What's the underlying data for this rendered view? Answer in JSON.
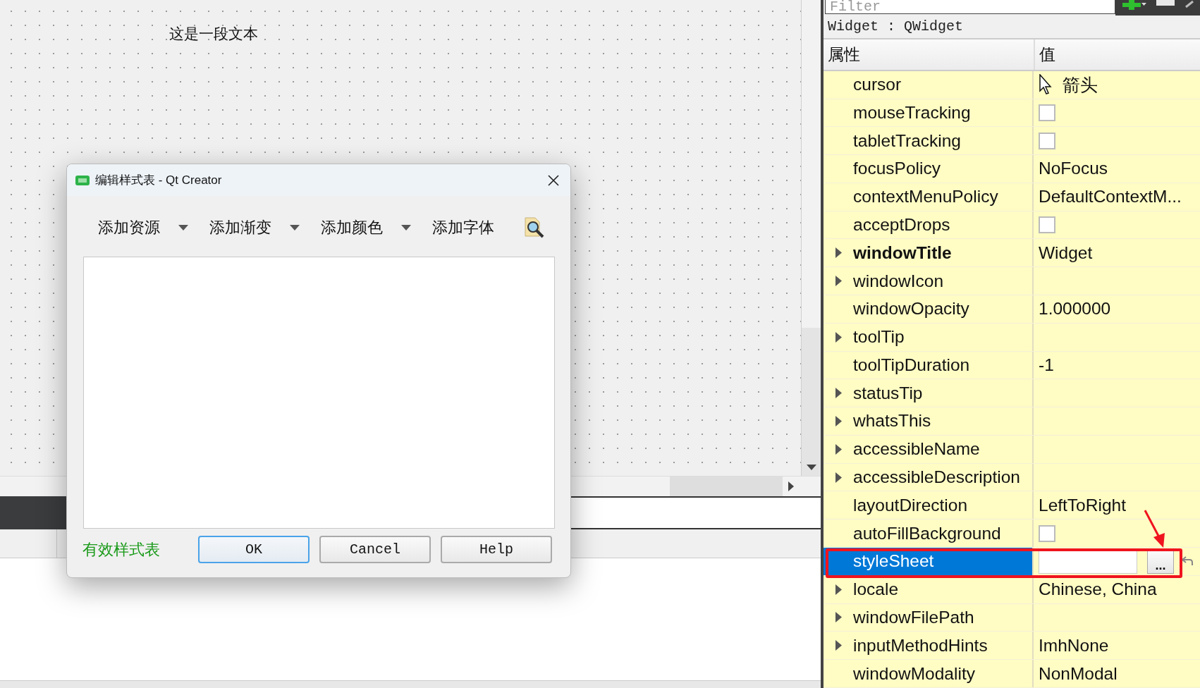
{
  "canvas": {
    "label": "这是一段文本"
  },
  "dialog": {
    "title": "编辑样式表 - Qt Creator",
    "toolbar": [
      {
        "label": "添加资源",
        "kind": "menu"
      },
      {
        "label": "添加渐变",
        "kind": "menu"
      },
      {
        "label": "添加颜色",
        "kind": "menu"
      },
      {
        "label": "添加字体",
        "kind": "plain"
      }
    ],
    "status": "有效样式表",
    "buttons": [
      {
        "label": "OK",
        "default": true
      },
      {
        "label": "Cancel",
        "default": false
      },
      {
        "label": "Help",
        "default": false
      }
    ]
  },
  "property_editor": {
    "filter": {
      "placeholder": "Filter"
    },
    "object": "Widget : QWidget",
    "columns": [
      "属性",
      "值"
    ],
    "rows": [
      {
        "name": "cursor",
        "kind": "cursor",
        "value": "箭头",
        "expandable": false,
        "bold": false,
        "selected": false
      },
      {
        "name": "mouseTracking",
        "kind": "checkbox",
        "checked": false,
        "expandable": false,
        "bold": false,
        "selected": false
      },
      {
        "name": "tabletTracking",
        "kind": "checkbox",
        "checked": false,
        "expandable": false,
        "bold": false,
        "selected": false
      },
      {
        "name": "focusPolicy",
        "kind": "text",
        "value": "NoFocus",
        "expandable": false,
        "bold": false,
        "selected": false
      },
      {
        "name": "contextMenuPolicy",
        "kind": "text",
        "value": "DefaultContextM...",
        "expandable": false,
        "bold": false,
        "selected": false
      },
      {
        "name": "acceptDrops",
        "kind": "checkbox",
        "checked": false,
        "expandable": false,
        "bold": false,
        "selected": false
      },
      {
        "name": "windowTitle",
        "kind": "text",
        "value": "Widget",
        "expandable": true,
        "bold": true,
        "selected": false
      },
      {
        "name": "windowIcon",
        "kind": "empty",
        "expandable": true,
        "bold": false,
        "selected": false
      },
      {
        "name": "windowOpacity",
        "kind": "text",
        "value": "1.000000",
        "expandable": false,
        "bold": false,
        "selected": false
      },
      {
        "name": "toolTip",
        "kind": "empty",
        "expandable": true,
        "bold": false,
        "selected": false
      },
      {
        "name": "toolTipDuration",
        "kind": "text",
        "value": "-1",
        "expandable": false,
        "bold": false,
        "selected": false
      },
      {
        "name": "statusTip",
        "kind": "empty",
        "expandable": true,
        "bold": false,
        "selected": false
      },
      {
        "name": "whatsThis",
        "kind": "empty",
        "expandable": true,
        "bold": false,
        "selected": false
      },
      {
        "name": "accessibleName",
        "kind": "empty",
        "expandable": true,
        "bold": false,
        "selected": false
      },
      {
        "name": "accessibleDescription",
        "kind": "empty",
        "expandable": true,
        "bold": false,
        "selected": false
      },
      {
        "name": "layoutDirection",
        "kind": "text",
        "value": "LeftToRight",
        "expandable": false,
        "bold": false,
        "selected": false
      },
      {
        "name": "autoFillBackground",
        "kind": "checkbox",
        "checked": false,
        "expandable": false,
        "bold": false,
        "selected": false
      },
      {
        "name": "styleSheet",
        "kind": "editor",
        "button": "...",
        "expandable": false,
        "bold": false,
        "selected": true
      },
      {
        "name": "locale",
        "kind": "text",
        "value": "Chinese, China",
        "expandable": true,
        "bold": false,
        "selected": false
      },
      {
        "name": "windowFilePath",
        "kind": "empty",
        "expandable": true,
        "bold": false,
        "selected": false
      },
      {
        "name": "inputMethodHints",
        "kind": "text",
        "value": "ImhNone",
        "expandable": true,
        "bold": false,
        "selected": false
      },
      {
        "name": "windowModality",
        "kind": "text",
        "value": "NonModal",
        "expandable": false,
        "bold": false,
        "selected": false
      }
    ]
  }
}
